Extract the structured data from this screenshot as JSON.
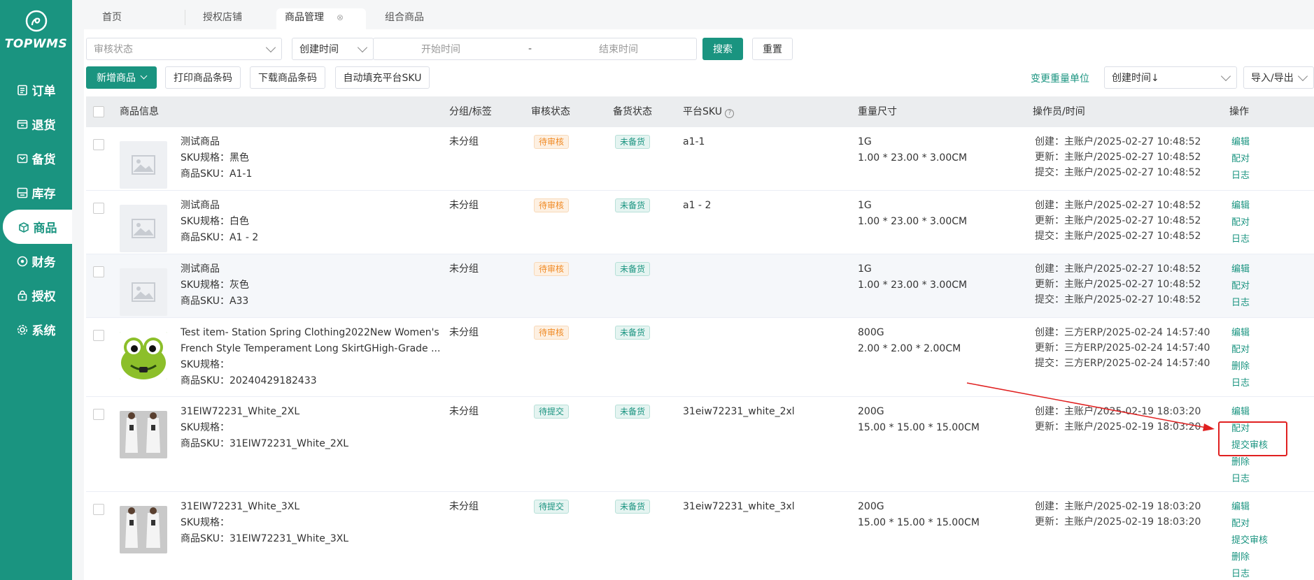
{
  "app": {
    "logo_text": "TOPWMS"
  },
  "sidebar": {
    "items": [
      {
        "label": "订单",
        "icon": "order-icon"
      },
      {
        "label": "退货",
        "icon": "return-icon"
      },
      {
        "label": "备货",
        "icon": "stock-prep-icon"
      },
      {
        "label": "库存",
        "icon": "inventory-icon"
      },
      {
        "label": "商品",
        "icon": "product-icon"
      },
      {
        "label": "财务",
        "icon": "finance-icon"
      },
      {
        "label": "授权",
        "icon": "auth-icon"
      },
      {
        "label": "系统",
        "icon": "settings-icon"
      }
    ],
    "active_index": 4
  },
  "tabs": [
    {
      "label": "首页"
    },
    {
      "label": "授权店铺"
    },
    {
      "label": "商品管理",
      "active": true
    },
    {
      "label": "组合商品"
    }
  ],
  "filters": {
    "review_status_placeholder": "审核状态",
    "time_type": "创建时间",
    "start_placeholder": "开始时间",
    "date_sep": "-",
    "end_placeholder": "结束时间",
    "search_label": "搜索",
    "reset_label": "重置"
  },
  "toolbar": {
    "add_label": "新增商品",
    "print_label": "打印商品条码",
    "download_label": "下载商品条码",
    "autofill_label": "自动填充平台SKU",
    "change_weight_label": "变更重量单位",
    "sort_label": "创建时间↓",
    "import_export_label": "导入/导出"
  },
  "table": {
    "headers": {
      "info": "商品信息",
      "group": "分组/标签",
      "review": "审核状态",
      "stock": "备货状态",
      "platform_sku": "平台SKU",
      "weight": "重量尺寸",
      "operator": "操作员/时间",
      "ops": "操作"
    },
    "rows": [
      {
        "name": "测试商品",
        "sku_spec": "SKU规格：黑色",
        "sku": "商品SKU：A1-1",
        "group": "未分组",
        "review": "待审核",
        "stock": "未备货",
        "platform_sku": "a1-1",
        "weight": "1G",
        "dims": "1.00 * 23.00 * 3.00CM",
        "log": [
          "创建：主账户/2025-02-27 10:48:52",
          "更新：主账户/2025-02-27 10:48:52",
          "提交：主账户/2025-02-27 10:48:52"
        ],
        "ops": [
          "编辑",
          "配对",
          "日志"
        ]
      },
      {
        "name": "测试商品",
        "sku_spec": "SKU规格：白色",
        "sku": "商品SKU：A1 - 2",
        "group": "未分组",
        "review": "待审核",
        "stock": "未备货",
        "platform_sku": "a1 - 2",
        "weight": "1G",
        "dims": "1.00 * 23.00 * 3.00CM",
        "log": [
          "创建：主账户/2025-02-27 10:48:52",
          "更新：主账户/2025-02-27 10:48:52",
          "提交：主账户/2025-02-27 10:48:52"
        ],
        "ops": [
          "编辑",
          "配对",
          "日志"
        ]
      },
      {
        "name": "测试商品",
        "sku_spec": "SKU规格：灰色",
        "sku": "商品SKU：A33",
        "group": "未分组",
        "review": "待审核",
        "stock": "未备货",
        "platform_sku": "",
        "weight": "1G",
        "dims": "1.00 * 23.00 * 3.00CM",
        "log": [
          "创建：主账户/2025-02-27 10:48:52",
          "更新：主账户/2025-02-27 10:48:52",
          "提交：主账户/2025-02-27 10:48:52"
        ],
        "ops": [
          "编辑",
          "配对",
          "日志"
        ]
      },
      {
        "name": "Test item- Station Spring Clothing2022New Women's",
        "name2": "French Style Temperament Long SkirtGHigh-Grade ...",
        "sku_spec": "SKU规格：",
        "sku": "商品SKU：20240429182433",
        "group": "未分组",
        "review": "待审核",
        "stock": "未备货",
        "platform_sku": "",
        "weight": "800G",
        "dims": "2.00 * 2.00 * 2.00CM",
        "log": [
          "创建：三方ERP/2025-02-24 14:57:40",
          "更新：三方ERP/2025-02-24 14:57:40",
          "提交：三方ERP/2025-02-24 14:57:40"
        ],
        "ops": [
          "编辑",
          "配对",
          "删除",
          "日志"
        ]
      },
      {
        "name": "31EIW72231_White_2XL",
        "sku_spec": "SKU规格：",
        "sku": "商品SKU：31EIW72231_White_2XL",
        "group": "未分组",
        "review": "待提交",
        "stock": "未备货",
        "platform_sku": "31eiw72231_white_2xl",
        "weight": "200G",
        "dims": "15.00 * 15.00 * 15.00CM",
        "log": [
          "创建：主账户/2025-02-19 18:03:20",
          "更新：主账户/2025-02-19 18:03:20"
        ],
        "ops": [
          "编辑",
          "配对",
          "提交审核",
          "删除",
          "日志"
        ]
      },
      {
        "name": "31EIW72231_White_3XL",
        "sku_spec": "SKU规格：",
        "sku": "商品SKU：31EIW72231_White_3XL",
        "group": "未分组",
        "review": "待提交",
        "stock": "未备货",
        "platform_sku": "31eiw72231_white_3xl",
        "weight": "200G",
        "dims": "15.00 * 15.00 * 15.00CM",
        "log": [
          "创建：主账户/2025-02-19 18:03:20",
          "更新：主账户/2025-02-19 18:03:20"
        ],
        "ops": [
          "编辑",
          "配对",
          "提交审核",
          "删除",
          "日志"
        ]
      }
    ]
  }
}
